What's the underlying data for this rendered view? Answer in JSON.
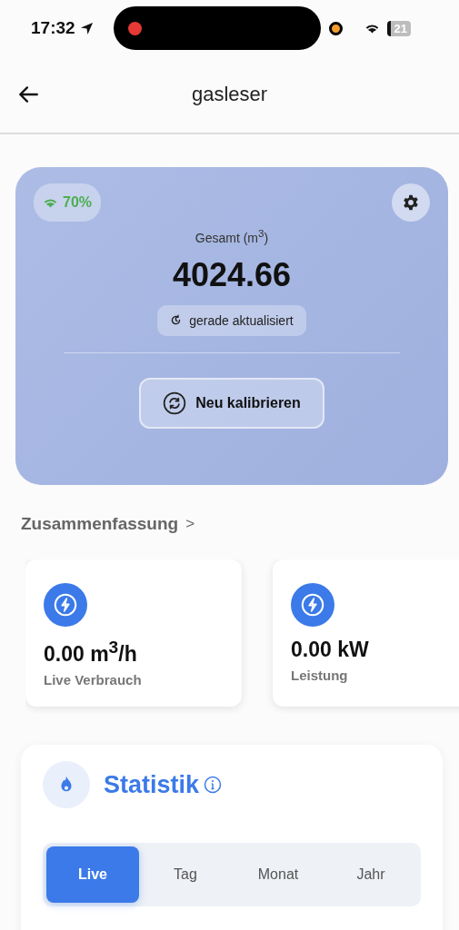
{
  "status_bar": {
    "time": "17:32",
    "battery": "21"
  },
  "header": {
    "title": "gasleser"
  },
  "meter": {
    "signal": "70%",
    "label": "Gesamt (m$^{3}$)",
    "value": "4024.66",
    "updated": "gerade aktualisiert",
    "button": "Neu kalibrieren"
  },
  "summary": {
    "title": "Zusammenfassung",
    "chevron": ">",
    "cards": [
      {
        "value": "0.00 m$^{3}$/h",
        "label": "Live Verbrauch"
      },
      {
        "value": "0.00 kW",
        "label": "Leistung"
      }
    ]
  },
  "statistics": {
    "title": "Statistik",
    "tabs": [
      {
        "label": "Live",
        "selected": true
      },
      {
        "label": "Tag",
        "selected": false
      },
      {
        "label": "Monat",
        "selected": false
      },
      {
        "label": "Jahr",
        "selected": false
      }
    ]
  }
}
